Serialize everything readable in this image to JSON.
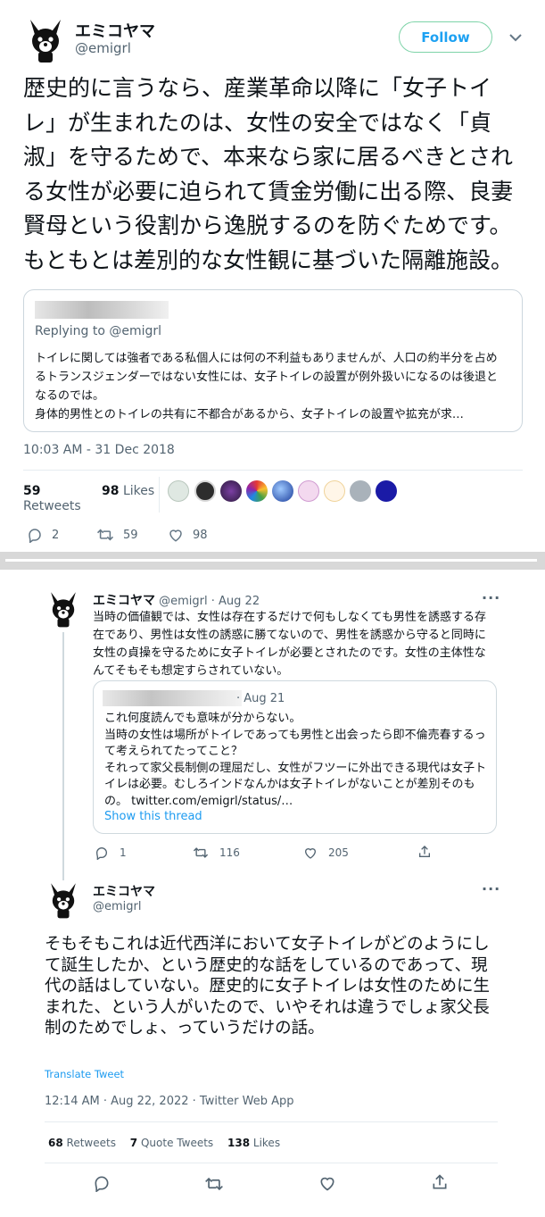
{
  "tweet1": {
    "name": "エミコヤマ",
    "handle": "@emigrl",
    "follow_label": "Follow",
    "body": "歴史的に言うなら、産業革命以降に「女子トイレ」が生まれたのは、女性の安全ではなく「貞淑」を守るためで、本来なら家に居るべきとされる女性が必要に迫られて賃金労働に出る際、良妻賢母という役割から逸脱するのを防ぐためです。もともとは差別的な女性観に基づいた隔離施設。",
    "quote": {
      "replying_to": "Replying to @emigrl",
      "text": "トイレに関しては強者である私個人には何の不利益もありませんが、人口の約半分を占めるトランスジェンダーではない女性には、女子トイレの設置が例外扱いになるのは後退となるのでは。\n身体的男性とのトイレの共有に不都合があるから、女子トイレの設置や拡充が求…"
    },
    "timestamp": "10:03 AM - 31 Dec 2018",
    "retweets_count": "59",
    "retweets_label": "Retweets",
    "likes_count": "98",
    "likes_label": "Likes",
    "reply_count": "2",
    "retweet_count": "59",
    "like_count": "98"
  },
  "tweet2": {
    "name": "エミコヤマ",
    "handle": "@emigrl",
    "date": "· Aug 22",
    "body": "当時の価値観では、女性は存在するだけで何もしなくても男性を誘惑する存在であり、男性は女性の誘惑に勝てないので、男性を誘惑から守ると同時に女性の貞操を守るために女子トイレが必要とされたのです。女性の主体性なんてそもそも想定すらされていない。",
    "quote": {
      "date": "· Aug 21",
      "text": "これ何度読んでも意味が分からない。\n当時の女性は場所がトイレであっても男性と出会ったら即不倫売春するって考えられてたってこと？\nそれって家父長制側の理屈だし、女性がフツーに外出できる現代は女子トイレは必要。むしろインドなんかは女子トイレがないことが差別そのもの。 twitter.com/emigrl/status/…",
      "show_thread": "Show this thread"
    },
    "reply_count": "1",
    "retweet_count": "116",
    "like_count": "205"
  },
  "tweet3": {
    "name": "エミコヤマ",
    "handle": "@emigrl",
    "body": "そもそもこれは近代西洋において女子トイレがどのようにして誕生したか、という歴史的な話をしているのであって、現代の話はしていない。歴史的に女子トイレは女性のために生まれた、という人がいたので、いやそれは違うでしょ家父長制のためでしょ、っていうだけの話。",
    "translate": "Translate Tweet",
    "timestamp": "12:14 AM · Aug 22, 2022 · Twitter Web App",
    "retweets_count": "68",
    "retweets_label": "Retweets",
    "quotes_count": "7",
    "quotes_label": "Quote Tweets",
    "likes_count": "138",
    "likes_label": "Likes"
  },
  "colors": {
    "accent": "#1d9bf0",
    "follow": "#1da1f2",
    "text": "#0f1419",
    "muted": "#536471"
  }
}
